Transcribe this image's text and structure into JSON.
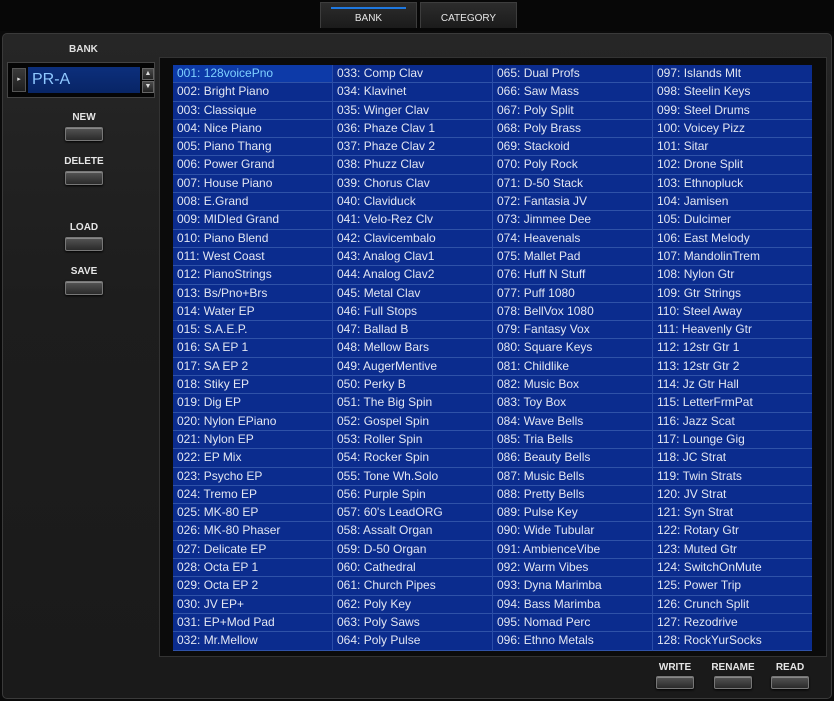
{
  "tabs": {
    "bank": "BANK",
    "category": "CATEGORY"
  },
  "left": {
    "bank_label": "BANK",
    "bank_value": "PR-A",
    "new_label": "NEW",
    "delete_label": "DELETE",
    "load_label": "LOAD",
    "save_label": "SAVE"
  },
  "bottom": {
    "write_label": "WRITE",
    "rename_label": "RENAME",
    "read_label": "READ"
  },
  "selected_patch": "001: 128voicePno",
  "patches": [
    [
      "001: 128voicePno",
      "002: Bright Piano",
      "003: Classique",
      "004: Nice Piano",
      "005: Piano Thang",
      "006: Power Grand",
      "007: House Piano",
      "008: E.Grand",
      "009: MIDIed Grand",
      "010: Piano Blend",
      "011: West Coast",
      "012: PianoStrings",
      "013: Bs/Pno+Brs",
      "014: Water EP",
      "015: S.A.E.P.",
      "016: SA EP 1",
      "017: SA EP 2",
      "018: Stiky EP",
      "019: Dig EP",
      "020: Nylon EPiano",
      "021: Nylon EP",
      "022: EP Mix",
      "023: Psycho EP",
      "024: Tremo EP",
      "025: MK-80 EP",
      "026: MK-80 Phaser",
      "027: Delicate EP",
      "028: Octa EP 1",
      "029: Octa EP 2",
      "030: JV EP+",
      "031: EP+Mod Pad",
      "032: Mr.Mellow"
    ],
    [
      "033: Comp Clav",
      "034: Klavinet",
      "035: Winger Clav",
      "036: Phaze Clav 1",
      "037: Phaze Clav 2",
      "038: Phuzz Clav",
      "039: Chorus Clav",
      "040: Claviduck",
      "041: Velo-Rez Clv",
      "042: Clavicembalo",
      "043: Analog Clav1",
      "044: Analog Clav2",
      "045: Metal Clav",
      "046: Full Stops",
      "047: Ballad B",
      "048: Mellow Bars",
      "049: AugerMentive",
      "050: Perky B",
      "051: The Big Spin",
      "052: Gospel Spin",
      "053: Roller Spin",
      "054: Rocker Spin",
      "055: Tone Wh.Solo",
      "056: Purple Spin",
      "057: 60's LeadORG",
      "058: Assalt Organ",
      "059: D-50 Organ",
      "060: Cathedral",
      "061: Church Pipes",
      "062: Poly Key",
      "063: Poly Saws",
      "064: Poly Pulse"
    ],
    [
      "065: Dual Profs",
      "066: Saw Mass",
      "067: Poly Split",
      "068: Poly Brass",
      "069: Stackoid",
      "070: Poly Rock",
      "071: D-50 Stack",
      "072: Fantasia JV",
      "073: Jimmee Dee",
      "074: Heavenals",
      "075: Mallet Pad",
      "076: Huff N Stuff",
      "077: Puff 1080",
      "078: BellVox 1080",
      "079: Fantasy Vox",
      "080: Square Keys",
      "081: Childlike",
      "082: Music Box",
      "083: Toy Box",
      "084: Wave Bells",
      "085: Tria Bells",
      "086: Beauty Bells",
      "087: Music Bells",
      "088: Pretty Bells",
      "089: Pulse Key",
      "090: Wide Tubular",
      "091: AmbienceVibe",
      "092: Warm Vibes",
      "093: Dyna Marimba",
      "094: Bass Marimba",
      "095: Nomad Perc",
      "096: Ethno Metals"
    ],
    [
      "097: Islands Mlt",
      "098: Steelin Keys",
      "099: Steel Drums",
      "100: Voicey Pizz",
      "101: Sitar",
      "102: Drone Split",
      "103: Ethnopluck",
      "104: Jamisen",
      "105: Dulcimer",
      "106: East Melody",
      "107: MandolinTrem",
      "108: Nylon Gtr",
      "109: Gtr Strings",
      "110: Steel Away",
      "111: Heavenly Gtr",
      "112: 12str Gtr 1",
      "113: 12str Gtr 2",
      "114: Jz Gtr Hall",
      "115: LetterFrmPat",
      "116: Jazz Scat",
      "117: Lounge Gig",
      "118: JC Strat",
      "119: Twin Strats",
      "120: JV Strat",
      "121: Syn Strat",
      "122: Rotary Gtr",
      "123: Muted Gtr",
      "124: SwitchOnMute",
      "125: Power Trip",
      "126: Crunch Split",
      "127: Rezodrive",
      "128: RockYurSocks"
    ]
  ]
}
